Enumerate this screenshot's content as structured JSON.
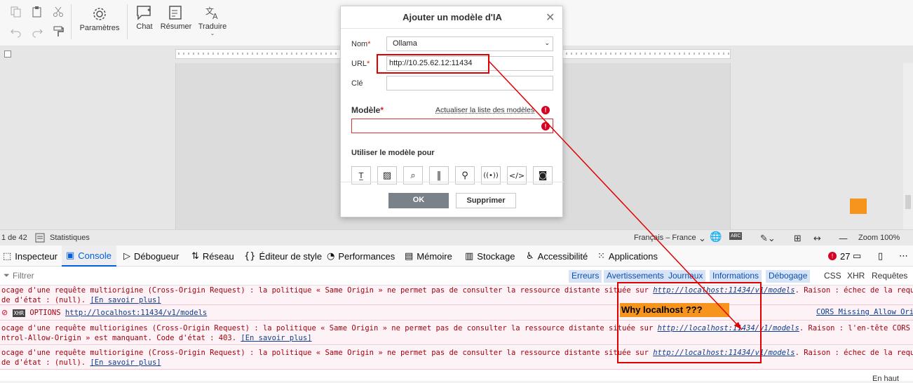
{
  "toolbar": {
    "settings_label": "Paramètres",
    "chat_label": "Chat",
    "summarize_label": "Résumer",
    "translate_label": "Traduire"
  },
  "status": {
    "page": "1 de 42",
    "stats": "Statistiques",
    "language": "Français – France",
    "zoom": "Zoom 100%"
  },
  "dialog": {
    "title": "Ajouter un modèle d'IA",
    "name_label": "Nom",
    "name_value": "Ollama",
    "url_label": "URL",
    "url_value": "http://10.25.62.12:11434",
    "key_label": "Clé",
    "model_label": "Modèle",
    "refresh_link": "Actualiser la liste des modèles",
    "use_for_label": "Utiliser le modèle pour",
    "ok_label": "OK",
    "delete_label": "Supprimer"
  },
  "devtools": {
    "tabs": [
      "Inspecteur",
      "Console",
      "Débogueur",
      "Réseau",
      "Éditeur de style",
      "Performances",
      "Mémoire",
      "Stockage",
      "Accessibilité",
      "Applications"
    ],
    "error_count": "27",
    "filter_placeholder": "Filtrer",
    "filters": [
      "Erreurs",
      "Avertissements",
      "Journaux",
      "Informations",
      "Débogage"
    ],
    "extra_filters": [
      "CSS",
      "XHR",
      "Requêtes"
    ],
    "messages": [
      {
        "l1a": "ocage d'une requête multiorigine (Cross-Origin Request) : la politique « Same Origin » ne permet pas de consulter la ressource distante située sur ",
        "l1link": "http://localhost:11434/v1/models",
        "l1b": ". Raison : échec de la requête CORS.",
        "l2a": " de d'état : (null). ",
        "l2link": "[En savoir plus]"
      },
      {
        "method": "OPTIONS",
        "xhr": "XHR",
        "url": "http://localhost:11434/v1/models",
        "tag": "CORS Missing Allow Origi"
      },
      {
        "l1a": "ocage d'une requête multiorigines (Cross-Origin Request) : la politique « Same Origin » ne permet pas de consulter la ressource distante située sur ",
        "l1link": "http://localhost:11434/v1/models",
        "l1b": ". Raison : l'en-tête CORS « Access-",
        "l2a": "ntrol-Allow-Origin » est manquant. Code d'état : 403. ",
        "l2link": "[En savoir plus]"
      },
      {
        "l1a": "ocage d'une requête multiorigine (Cross-Origin Request) : la politique « Same Origin » ne permet pas de consulter la ressource distante située sur ",
        "l1link": "http://localhost:11434/v1/models",
        "l1b": ". Raison : échec de la requête CORS.",
        "l2a": " de d'état : (null). ",
        "l2link": "[En savoir plus]"
      }
    ],
    "bottom_right": "En haut"
  },
  "annotation": {
    "note": "Why localhost ???",
    "color_highlight": "#f7941d",
    "color_marker": "#e00000"
  }
}
